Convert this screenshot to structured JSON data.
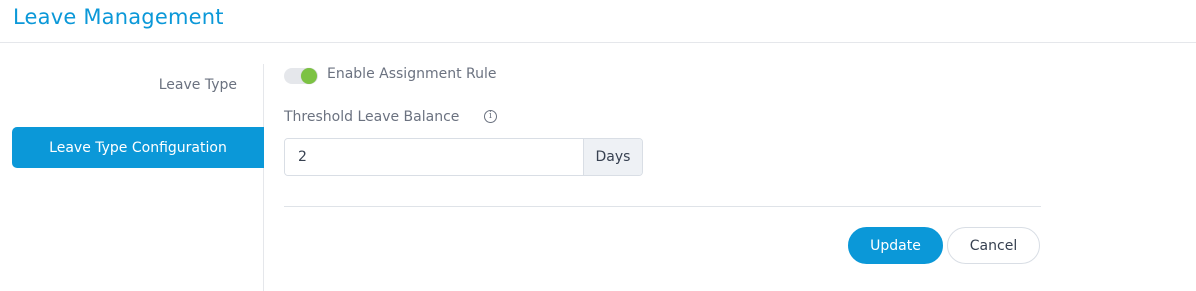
{
  "header": {
    "title": "Leave Management"
  },
  "sidebar": {
    "items": [
      {
        "label": "Leave Type"
      },
      {
        "label": "Leave Type Configuration",
        "active": true
      }
    ]
  },
  "form": {
    "assignment_toggle": {
      "label": "Enable Assignment Rule",
      "enabled": true
    },
    "threshold": {
      "label": "Threshold Leave Balance",
      "info_icon": "info-icon",
      "value": "2",
      "unit": "Days"
    },
    "actions": {
      "update_label": "Update",
      "cancel_label": "Cancel"
    }
  },
  "colors": {
    "accent": "#0b98d8",
    "toggle_on": "#7cc243"
  }
}
